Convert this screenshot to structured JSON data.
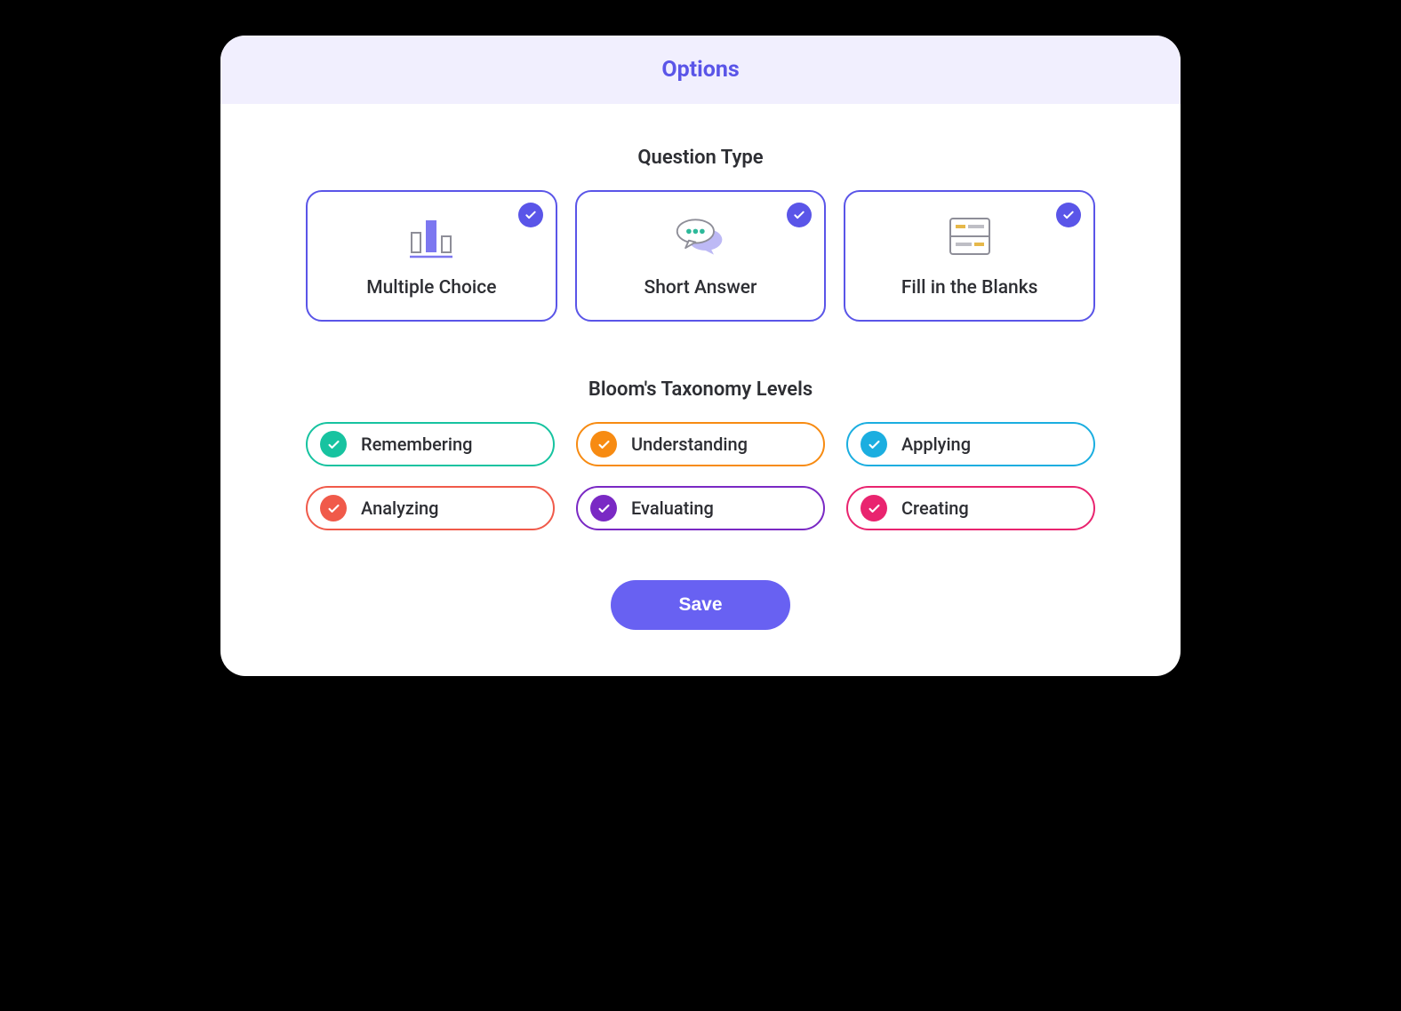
{
  "header": {
    "title": "Options"
  },
  "question_type": {
    "title": "Question Type",
    "items": [
      {
        "label": "Multiple Choice",
        "icon": "bar-chart-icon",
        "selected": true
      },
      {
        "label": "Short Answer",
        "icon": "chat-bubbles-icon",
        "selected": true
      },
      {
        "label": "Fill in the Blanks",
        "icon": "form-lines-icon",
        "selected": true
      }
    ]
  },
  "bloom": {
    "title": "Bloom's Taxonomy Levels",
    "items": [
      {
        "label": "Remembering",
        "color": "#17C3A0",
        "selected": true
      },
      {
        "label": "Understanding",
        "color": "#F78B12",
        "selected": true
      },
      {
        "label": "Applying",
        "color": "#1BAEE0",
        "selected": true
      },
      {
        "label": "Analyzing",
        "color": "#F05A4A",
        "selected": true
      },
      {
        "label": "Evaluating",
        "color": "#7A29C4",
        "selected": true
      },
      {
        "label": "Creating",
        "color": "#E9246F",
        "selected": true
      }
    ]
  },
  "actions": {
    "save_label": "Save"
  },
  "colors": {
    "accent": "#5A55E8"
  }
}
